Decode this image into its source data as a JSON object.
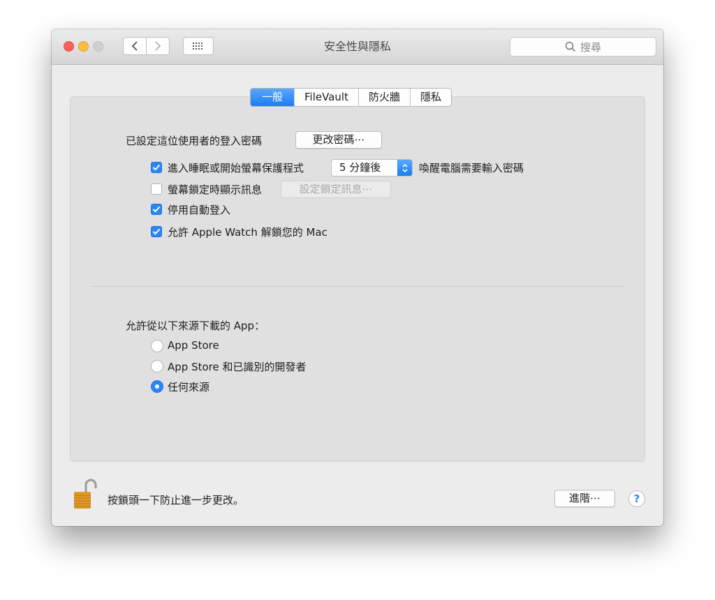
{
  "window": {
    "title": "安全性與隱私",
    "search_placeholder": "搜尋",
    "icons": [
      "back-arrow-icon",
      "forward-arrow-icon",
      "show-all-grid-icon",
      "search-icon"
    ]
  },
  "tabs": [
    {
      "label": "一般",
      "active": true
    },
    {
      "label": "FileVault",
      "active": false
    },
    {
      "label": "防火牆",
      "active": false
    },
    {
      "label": "隱私",
      "active": false
    }
  ],
  "general": {
    "password_label": "已設定這位使用者的登入密碼",
    "change_password_button": "更改密碼⋯",
    "options": [
      {
        "label": "進入睡眠或開始螢幕保護程式",
        "checked": true
      },
      {
        "label": "螢幕鎖定時顯示訊息",
        "checked": false
      },
      {
        "label": "停用自動登入",
        "checked": true
      },
      {
        "label": "允許 Apple Watch 解鎖您的 Mac",
        "checked": true
      }
    ],
    "require_password_select": "5 分鐘後",
    "require_password_suffix": "喚醒電腦需要輸入密碼",
    "set_lock_message_button": "設定鎖定訊息⋯"
  },
  "downloads": {
    "label": "允許從以下來源下載的 App：",
    "options": [
      {
        "label": "App Store",
        "selected": false
      },
      {
        "label": "App Store 和已識別的開發者",
        "selected": false
      },
      {
        "label": "任何來源",
        "selected": true
      }
    ]
  },
  "footer": {
    "lock_text": "按鎖頭一下防止進一步更改。",
    "advanced_button": "進階⋯",
    "help_label": "?"
  },
  "colors": {
    "accent": "#2a86f7",
    "close": "#fc605c",
    "minimize": "#fdbc40",
    "lock": "#e09a2a"
  }
}
